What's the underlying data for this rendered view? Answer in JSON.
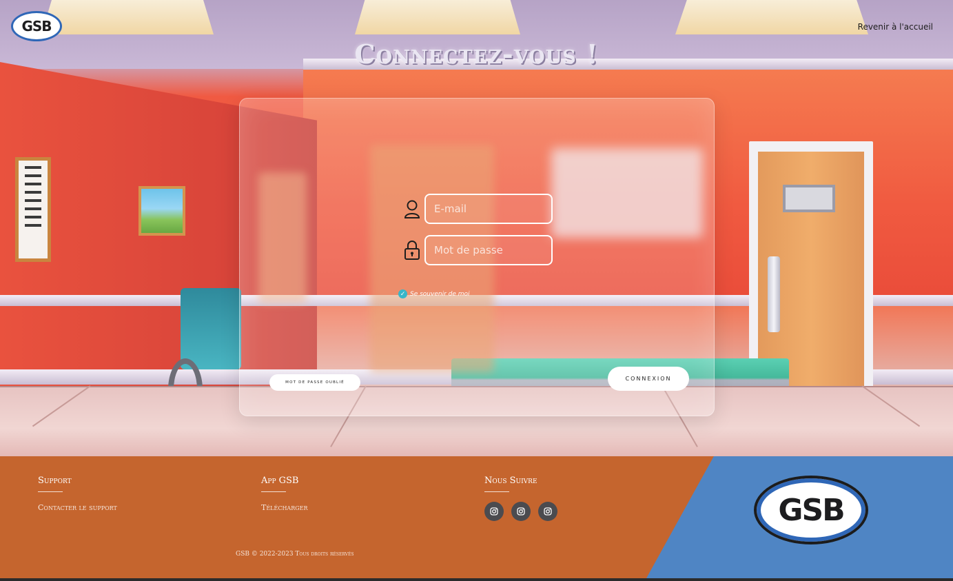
{
  "brand": {
    "logo_text": "GSB"
  },
  "header": {
    "back_link": "Revenir à l'accueil"
  },
  "page_title": "Connectez-vous !",
  "login_form": {
    "email_placeholder": "E-mail",
    "password_placeholder": "Mot de passe",
    "remember_label": "Se souvenir de moi",
    "remember_checked": true,
    "forgot_button": "Mot de passe oublié",
    "submit_button": "Connexion",
    "email_icon": "user-icon",
    "password_icon": "lock-icon"
  },
  "footer": {
    "support": {
      "title": "Support",
      "link": "Contacter le support"
    },
    "app": {
      "title": "App GSB",
      "link": "Télécharger"
    },
    "follow": {
      "title": "Nous Suivre",
      "socials": [
        "instagram-icon",
        "instagram-icon",
        "instagram-icon"
      ]
    },
    "copyright": "GSB © 2022-2023 Tous droits réservés",
    "logo_text": "GSB"
  },
  "colors": {
    "footer_orange": "#c5652e",
    "footer_blue": "#4f85c4",
    "checkbox_accent": "#38b6c9"
  }
}
